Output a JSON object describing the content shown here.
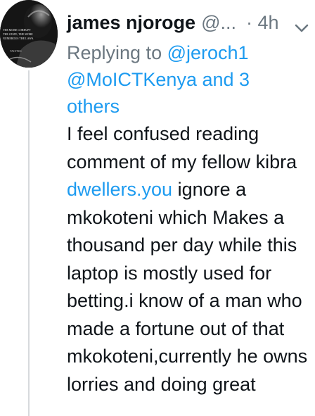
{
  "tweet": {
    "author": {
      "name": "james njoroge",
      "handle": "@...",
      "avatar_text": "THE MORE CORRUPT THE STATE, THE MORE NUMEROUS THE LAWS. TACITUS"
    },
    "separator": "·",
    "time": "4h",
    "reply_to": {
      "prefix": "Replying to",
      "mention_1": "@jeroch1",
      "mention_2": "@MoICTKenya and 3 others"
    },
    "text": {
      "part_1": "I feel confused reading comment of my fellow kibra",
      "link": "dwellers.you",
      "part_2": "ignore a mkokoteni which Makes a thousand per day while this laptop is mostly used for betting.i know of a man who made a fortune out of that mkokoteni,currently he owns lorries and doing great"
    },
    "icons": {
      "more": "chevron-down-icon"
    },
    "colors": {
      "link": "#1d9bf0",
      "secondary_text": "#6b7780",
      "thread_line": "#d7dadd"
    }
  }
}
